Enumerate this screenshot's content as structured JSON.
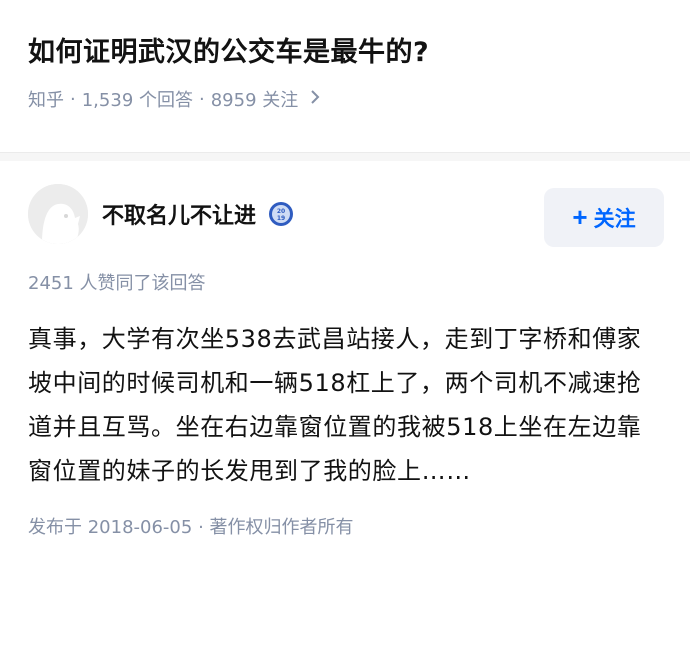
{
  "question": {
    "title": "如何证明武汉的公交车是最牛的?",
    "source": "知乎",
    "answer_count": "1,539 个回答",
    "follow_count": "8959 关注",
    "chevron_icon": "chevron-right-icon"
  },
  "answer": {
    "author_name": "不取名儿不让进",
    "badge_icon": "zhihu-2019-badge-icon",
    "badge_text": "2019",
    "follow_button": "关注",
    "follow_plus": "+",
    "likes_text": "2451 人赞同了该回答",
    "content": "真事，大学有次坐538去武昌站接人，走到丁字桥和傅家坡中间的时候司机和一辆518杠上了，两个司机不减速抢道并且互骂。坐在右边靠窗位置的我被518上坐在左边靠窗位置的妹子的长发甩到了我的脸上……",
    "published": "发布于 2018-06-05",
    "copyright": "著作权归作者所有"
  },
  "colors": {
    "accent": "#0066ff",
    "meta": "#8590a6",
    "button_bg": "#f0f2f7"
  }
}
